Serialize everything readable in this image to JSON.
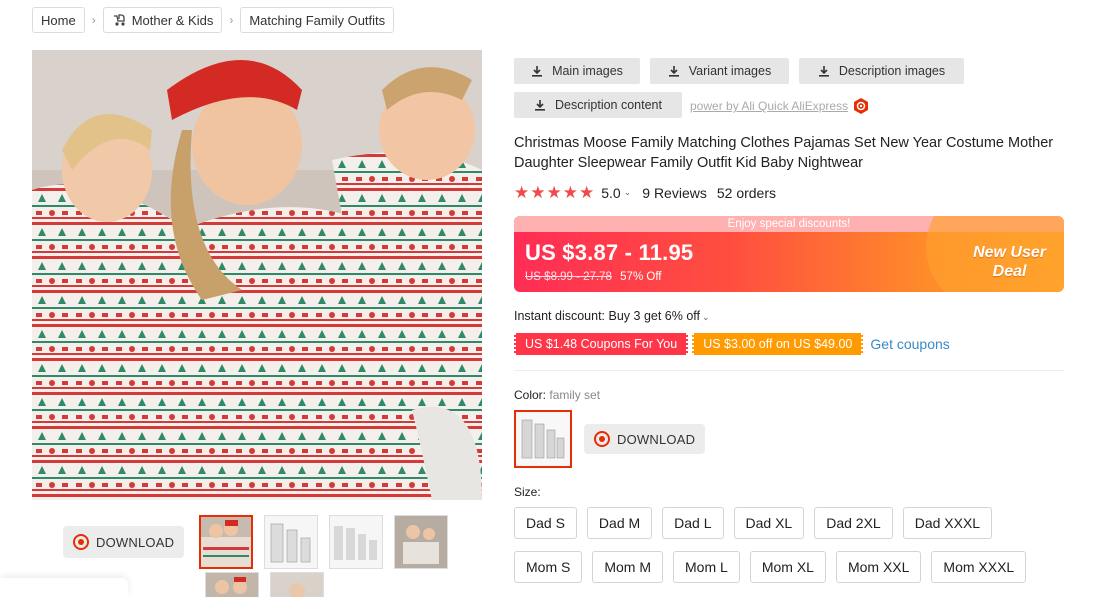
{
  "breadcrumb": {
    "items": [
      {
        "label": "Home"
      },
      {
        "label": "Mother & Kids"
      },
      {
        "label": "Matching Family Outfits"
      }
    ],
    "separator": "›"
  },
  "toolbar": {
    "main_images": "Main images",
    "variant_images": "Variant images",
    "description_images": "Description images",
    "description_content": "Description content",
    "powered_by": "power by Ali Quick AliExpress"
  },
  "product": {
    "title": "Christmas Moose Family Matching Clothes Pajamas Set New Year Costume Mother Daughter Sleepwear Family Outfit Kid Baby Nightwear",
    "rating": "5.0",
    "stars": 5,
    "reviews": "9 Reviews",
    "orders": "52 orders"
  },
  "price": {
    "banner": "Enjoy special discounts!",
    "current": "US $3.87 - 11.95",
    "original": "US $8.99 - 27.78",
    "discount": "57% Off",
    "deal_line1": "New User",
    "deal_line2": "Deal"
  },
  "discounts": {
    "instant": "Instant discount: Buy 3 get 6% off",
    "coupon1": "US $1.48 Coupons For You",
    "coupon2": "US $3.00 off on US $49.00",
    "get_coupons": "Get coupons"
  },
  "variants": {
    "color_label": "Color:",
    "color_value": "family set",
    "size_label": "Size:",
    "sizes_row1": [
      "Dad S",
      "Dad M",
      "Dad L",
      "Dad XL",
      "Dad 2XL",
      "Dad XXXL"
    ],
    "sizes_row2": [
      "Mom S",
      "Mom M",
      "Mom L",
      "Mom XL",
      "Mom XXL",
      "Mom XXXL"
    ]
  },
  "download_label": "DOWNLOAD",
  "colors": {
    "accent": "#e62e04",
    "price_gradient_start": "#ff2d55",
    "price_gradient_end": "#ffa928",
    "link": "#3a8bc7",
    "star": "#f04b4b"
  }
}
